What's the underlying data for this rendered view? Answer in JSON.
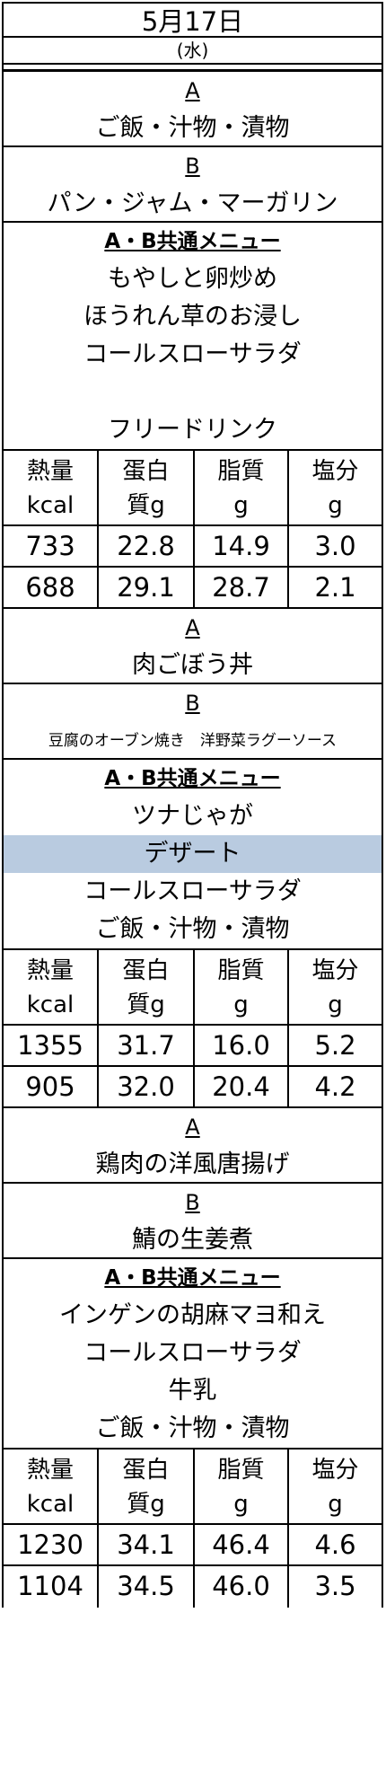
{
  "header": {
    "date": "5月17日",
    "weekday": "(水)"
  },
  "headers": [
    "熱量\nkcal",
    "蛋白\n質g",
    "脂質\ng",
    "塩分\ng"
  ],
  "blocks": [
    {
      "a_label": "A",
      "a_items": [
        "ご飯・汁物・漬物"
      ],
      "b_label": "B",
      "b_items": [
        "パン・ジャム・マーガリン"
      ],
      "common_label": "A・B共通メニュー",
      "common_items": [
        "もやしと卵炒め",
        "ほうれん草のお浸し",
        "コールスローサラダ",
        "",
        "フリードリンク"
      ],
      "nutrition": [
        [
          "733",
          "22.8",
          "14.9",
          "3.0"
        ],
        [
          "688",
          "29.1",
          "28.7",
          "2.1"
        ]
      ]
    },
    {
      "a_label": "A",
      "a_items": [
        "肉ごぼう丼"
      ],
      "b_label": "B",
      "b_items": [
        "豆腐のオーブン焼き　洋野菜ラグーソース"
      ],
      "common_label": "A・B共通メニュー",
      "common_items": [
        "ツナじゃが",
        "デザート",
        "コールスローサラダ",
        "ご飯・汁物・漬物"
      ],
      "highlight_item": "デザート",
      "nutrition": [
        [
          "1355",
          "31.7",
          "16.0",
          "5.2"
        ],
        [
          "905",
          "32.0",
          "20.4",
          "4.2"
        ]
      ]
    },
    {
      "a_label": "A",
      "a_items": [
        "鶏肉の洋風唐揚げ"
      ],
      "b_label": "B",
      "b_items": [
        "鯖の生姜煮"
      ],
      "common_label": "A・B共通メニュー",
      "common_items": [
        "インゲンの胡麻マヨ和え",
        "コールスローサラダ",
        "牛乳",
        "ご飯・汁物・漬物"
      ],
      "nutrition": [
        [
          "1230",
          "34.1",
          "46.4",
          "4.6"
        ],
        [
          "1104",
          "34.5",
          "46.0",
          "3.5"
        ]
      ]
    }
  ]
}
